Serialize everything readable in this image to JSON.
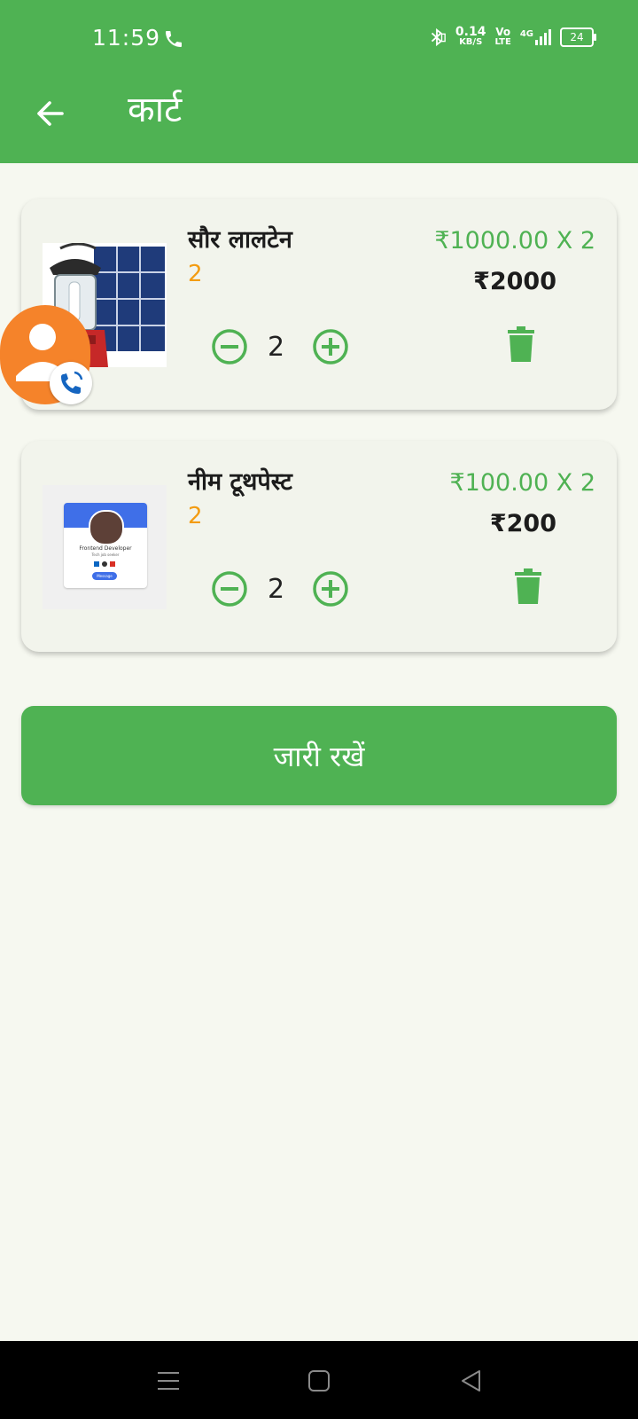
{
  "status": {
    "time": "11:59",
    "net_speed": "0.14",
    "net_unit": "KB/S",
    "volte_top": "Vo",
    "volte_bottom": "LTE",
    "network": "4G",
    "battery": "24"
  },
  "header": {
    "title": "कार्ट"
  },
  "cart": {
    "items": [
      {
        "name": "सौर लालटेन",
        "qty_label": "2",
        "unit_price": "₹1000.00 X 2",
        "total": "₹2000",
        "quantity": "2"
      },
      {
        "name": "नीम टूथपेस्ट",
        "qty_label": "2",
        "unit_price": "₹100.00 X 2",
        "total": "₹200",
        "quantity": "2"
      }
    ]
  },
  "profile_card": {
    "name": "Frontend Developer",
    "role": "Tech job seeker",
    "button": "Message"
  },
  "continue_label": "जारी रखें",
  "colors": {
    "primary": "#4FB253",
    "accent_orange": "#F39C12",
    "fab_orange": "#F5832A",
    "background": "#F6F8F0"
  },
  "icons": {
    "back": "arrow-left-icon",
    "minus": "minus-circle-icon",
    "plus": "plus-circle-icon",
    "delete": "trash-icon",
    "contact": "person-icon",
    "call": "phone-icon"
  }
}
